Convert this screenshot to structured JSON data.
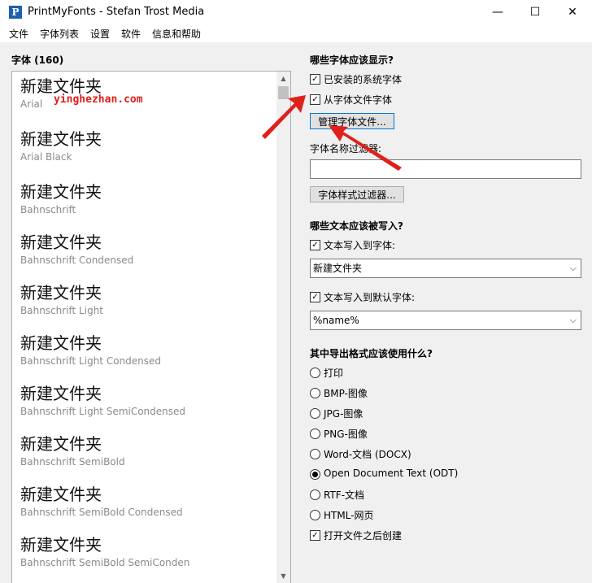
{
  "window": {
    "title": "PrintMyFonts - Stefan Trost Media",
    "icon_glyph": "P",
    "minimize_glyph": "—",
    "maximize_glyph": "☐",
    "close_glyph": "✕"
  },
  "menu": [
    "文件",
    "字体列表",
    "设置",
    "软件",
    "信息和帮助"
  ],
  "left": {
    "header": "字体 (160)",
    "fonts": [
      {
        "sample": "新建文件夹",
        "name": "Arial"
      },
      {
        "sample": "新建文件夹",
        "name": "Arial Black"
      },
      {
        "sample": "新建文件夹",
        "name": "Bahnschrift"
      },
      {
        "sample": "新建文件夹",
        "name": "Bahnschrift Condensed"
      },
      {
        "sample": "新建文件夹",
        "name": "Bahnschrift Light"
      },
      {
        "sample": "新建文件夹",
        "name": "Bahnschrift Light Condensed"
      },
      {
        "sample": "新建文件夹",
        "name": "Bahnschrift Light SemiCondensed"
      },
      {
        "sample": "新建文件夹",
        "name": "Bahnschrift SemiBold"
      },
      {
        "sample": "新建文件夹",
        "name": "Bahnschrift SemiBold Condensed"
      },
      {
        "sample": "新建文件夹",
        "name": "Bahnschrift SemiBold SemiConden"
      }
    ],
    "scroll_up_glyph": "▲",
    "scroll_down_glyph": "▼"
  },
  "watermark": "yinghezhan.com",
  "right": {
    "show_header": "哪些字体应该显示?",
    "show_installed": {
      "label": "已安装的系统字体",
      "checked": true
    },
    "show_from_files": {
      "label": "从字体文件字体",
      "checked": true
    },
    "manage_button": "管理字体文件...",
    "name_filter_label": "字体名称过滤器:",
    "name_filter_value": "",
    "style_filter_button": "字体样式过滤器...",
    "write_header": "哪些文本应该被写入?",
    "write_to_font": {
      "label": "文本写入到字体:",
      "checked": true
    },
    "write_to_font_value": "新建文件夹",
    "write_default": {
      "label": "文本写入到默认字体:",
      "checked": true
    },
    "write_default_value": "%name%",
    "combo_arrow": "⌵",
    "check_glyph": "✓",
    "export_header": "其中导出格式应该使用什么?",
    "export_options": [
      {
        "label": "打印",
        "selected": false
      },
      {
        "label": "BMP-图像",
        "selected": false
      },
      {
        "label": "JPG-图像",
        "selected": false
      },
      {
        "label": "PNG-图像",
        "selected": false
      },
      {
        "label": "Word-文档 (DOCX)",
        "selected": false
      },
      {
        "label": "Open Document Text (ODT)",
        "selected": true
      },
      {
        "label": "RTF-文档",
        "selected": false
      },
      {
        "label": "HTML-网页",
        "selected": false
      }
    ],
    "open_after": {
      "label": "打开文件之后创建",
      "checked": true
    }
  },
  "colors": {
    "accent": "#0078d7",
    "annotation": "#e0201b"
  }
}
